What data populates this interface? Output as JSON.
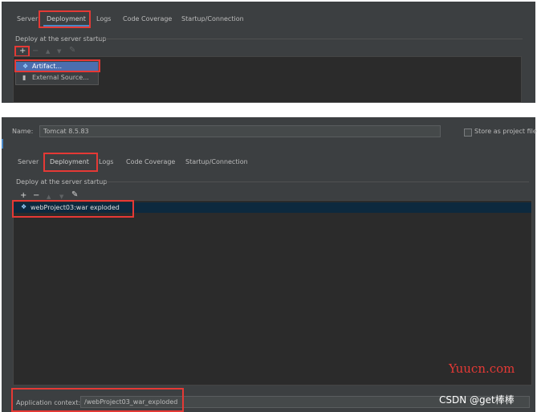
{
  "panel1": {
    "tabs": [
      "Server",
      "Deployment",
      "Logs",
      "Code Coverage",
      "Startup/Connection"
    ],
    "section_title": "Deploy at the server startup",
    "toolbar": {
      "add": "+",
      "remove": "−",
      "up": "▲",
      "down": "▼",
      "edit": "✎"
    },
    "popup_items": [
      "Artifact...",
      "External Source..."
    ]
  },
  "panel2": {
    "name_label": "Name:",
    "name_value": "Tomcat 8.5.83",
    "store_label": "Store as project file",
    "tabs": [
      "Server",
      "Deployment",
      "Logs",
      "Code Coverage",
      "Startup/Connection"
    ],
    "section_title": "Deploy at the server startup",
    "toolbar": {
      "add": "+",
      "remove": "−",
      "up": "▲",
      "down": "▼",
      "edit": "✎"
    },
    "artifact": "webProject03:war exploded",
    "app_context_label": "Application context:",
    "app_context_value": "/webProject03_war_exploded"
  },
  "watermarks": {
    "site": "Yuucn.com",
    "csdn": "CSDN @get棒棒"
  },
  "colors": {
    "highlight": "#e53935",
    "selection": "#0d293e",
    "popup_selected": "#4b6eaf",
    "tab_underline": "#4a88c7"
  }
}
